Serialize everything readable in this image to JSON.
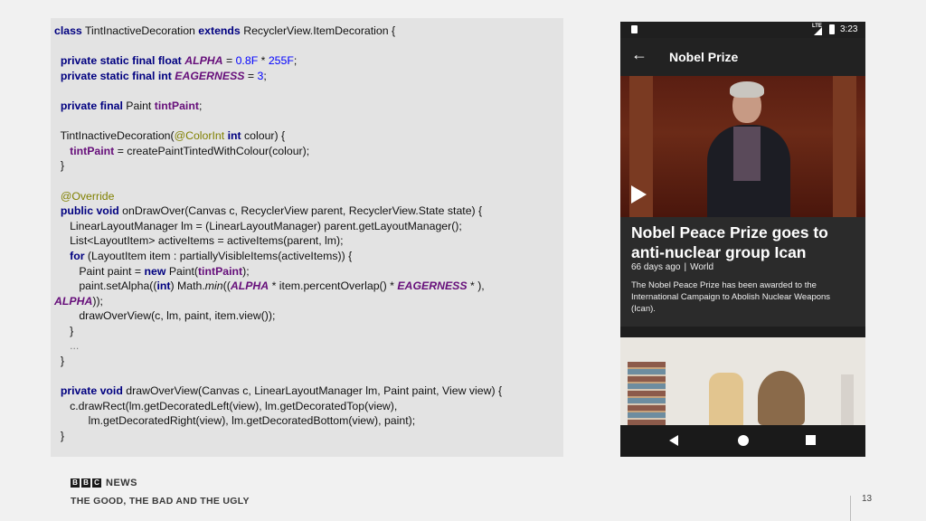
{
  "code": {
    "c1": "class",
    "c2": "TintInactiveDecoration",
    "c3": "extends",
    "c4": "RecyclerView.ItemDecoration {",
    "c5": "private static final float",
    "c6": "ALPHA",
    "c7": "=",
    "c8": "0.8F",
    "c9": "*",
    "c10": "255F",
    "c11": ";",
    "c12": "private static final int",
    "c13": "EAGERNESS",
    "c14": "=",
    "c15": "3",
    "c16": ";",
    "c17": "private final",
    "c18": "Paint",
    "c19": "tintPaint",
    "c20": ";",
    "c21": "TintInactiveDecoration(",
    "c22": "@ColorInt",
    "c23": "int",
    "c24": "colour) {",
    "c25": "tintPaint",
    "c26": "= createPaintTintedWithColour(colour);",
    "c27": "}",
    "c28": "@Override",
    "c29": "public void",
    "c30": "onDrawOver(Canvas c, RecyclerView parent, RecyclerView.State state) {",
    "c31": "LinearLayoutManager lm = (LinearLayoutManager) parent.getLayoutManager();",
    "c32": "List<LayoutItem> activeItems = activeItems(parent, lm);",
    "c33": "for",
    "c34": "(LayoutItem item : partiallyVisibleItems(activeItems)) {",
    "c35": "Paint paint =",
    "c36": "new",
    "c37": "Paint(",
    "c38": "tintPaint",
    "c39": ");",
    "c40": "paint.setAlpha((",
    "c41": "int",
    "c42": ") Math.",
    "c43": "min",
    "c44": "((",
    "c45": "ALPHA",
    "c46": "* item.percentOverlap() *",
    "c47": "EAGERNESS",
    "c48": "* ),",
    "c49": "ALPHA",
    "c50": "));",
    "c51": "drawOverView(c, lm, paint, item.view());",
    "c52": "}",
    "c53": "...",
    "c54": "}",
    "c55": "private void",
    "c56": "drawOverView(Canvas c, LinearLayoutManager lm, Paint paint, View view) {",
    "c57": "c.drawRect(lm.getDecoratedLeft(view), lm.getDecoratedTop(view),",
    "c58": "lm.getDecoratedRight(view), lm.getDecoratedBottom(view), paint);",
    "c59": "}"
  },
  "phone": {
    "status_lte": "LTE",
    "status_time": "3:23",
    "appbar_title": "Nobel Prize",
    "back_glyph": "←",
    "headline": "Nobel Peace Prize goes to anti-nuclear group Ican",
    "meta_age": "66 days ago",
    "meta_sep": "|",
    "meta_section": "World",
    "summary": "The Nobel Peace Prize has been awarded to the International Campaign to Abolish Nuclear Weapons (Ican)."
  },
  "footer": {
    "bbc_b1": "B",
    "bbc_b2": "B",
    "bbc_c": "C",
    "bbc_news": "NEWS",
    "title": "THE GOOD, THE BAD AND THE UGLY",
    "page_number": "13"
  },
  "colors": {
    "keyword": "#000080",
    "field": "#660e7a",
    "number": "#0000ff",
    "annotation": "#808000"
  }
}
